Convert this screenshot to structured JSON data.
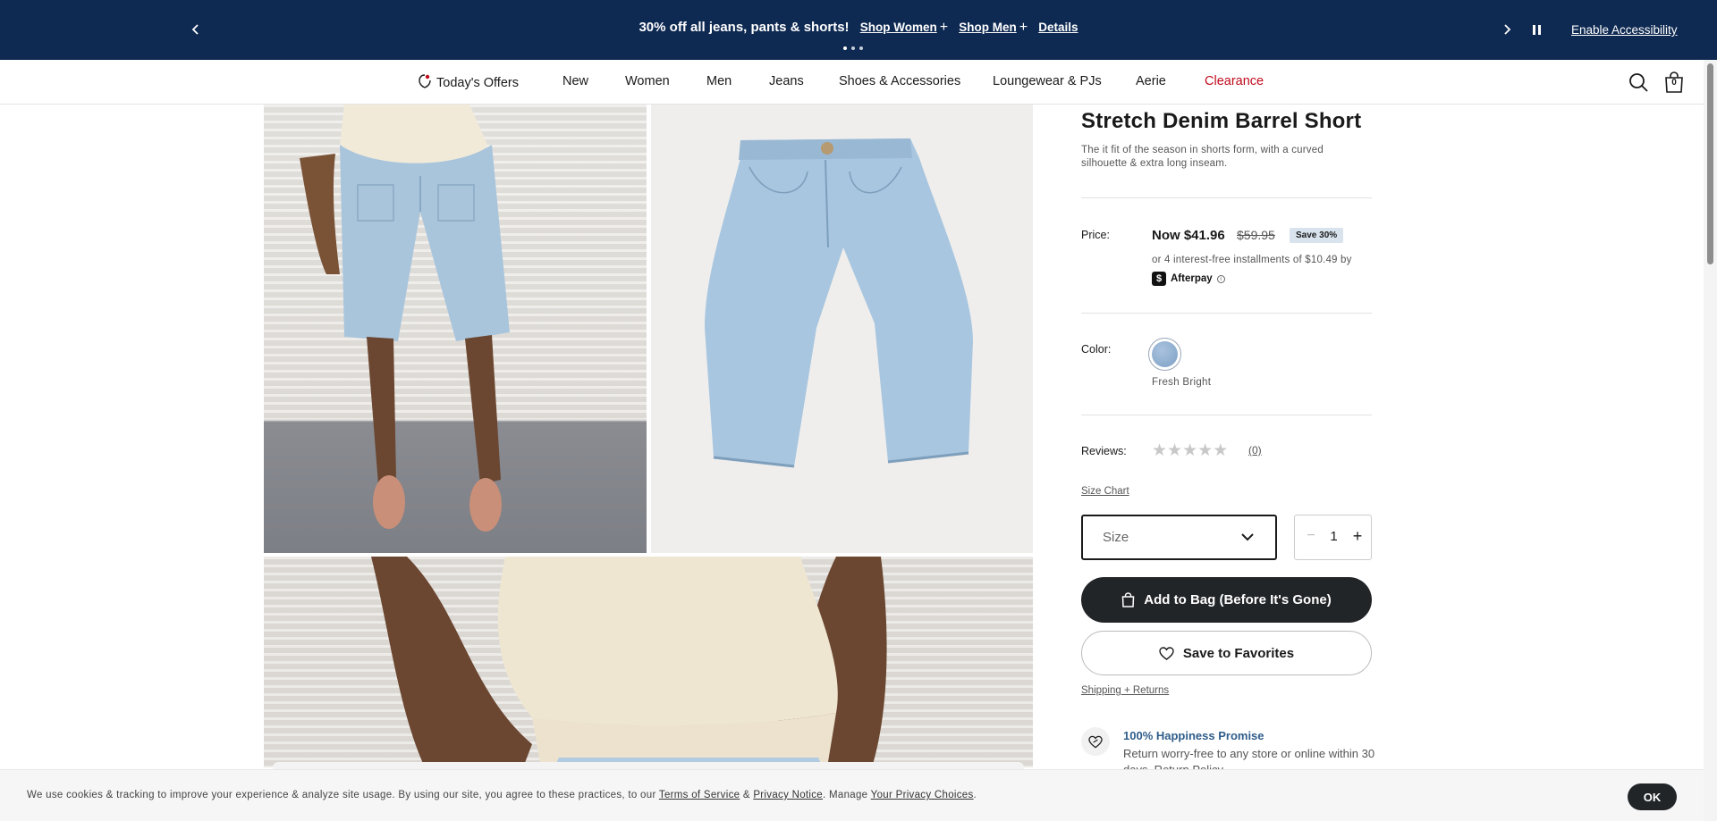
{
  "promo": {
    "message": "30% off all jeans, pants & shorts!",
    "shop_women": "Shop Women",
    "shop_men": "Shop Men",
    "details": "Details",
    "plus": "+",
    "enable_accessibility": "Enable Accessibility"
  },
  "nav": {
    "items": [
      "Today's Offers",
      "New",
      "Women",
      "Men",
      "Jeans",
      "Shoes & Accessories",
      "Loungewear & PJs",
      "Aerie",
      "Clearance"
    ],
    "bag_count": "0",
    "clearance_color": "#c00b1c"
  },
  "product": {
    "title": "Stretch Denim Barrel Short",
    "description": "The it fit of the season in shorts form, with a curved silhouette & extra long inseam.",
    "price_label": "Price:",
    "price_now": "Now $41.96",
    "price_was": "$59.95",
    "save_badge": "Save 30%",
    "afterpay_text": "or 4 interest-free installments of $10.49 by",
    "afterpay_brand": "Afterpay",
    "color_label": "Color:",
    "color_name": "Fresh Bright",
    "reviews_label": "Reviews:",
    "rating": 0,
    "review_count": "(0)",
    "size_chart": "Size Chart",
    "size_placeholder": "Size",
    "quantity": "1",
    "add_to_bag": "Add to Bag (Before It's Gone)",
    "save_favorites": "Save to Favorites",
    "shipping_returns": "Shipping + Returns",
    "promise_title": "100% Happiness Promise",
    "promise_text": "Return worry-free to any store or online within 30 days. Return Policy"
  },
  "cookie": {
    "text_before": "We use cookies & tracking to improve your experience & analyze site usage. By using our site, you agree to these practices, to our",
    "terms": "Terms of Service",
    "amp": "&",
    "privacy": "Privacy Notice",
    "manage": ". Manage",
    "choices": "Your Privacy Choices",
    "ok": "OK"
  },
  "colors": {
    "banner_bg": "#0f2a52",
    "primary_button": "#222528",
    "link_blue": "#2f5d8a"
  }
}
